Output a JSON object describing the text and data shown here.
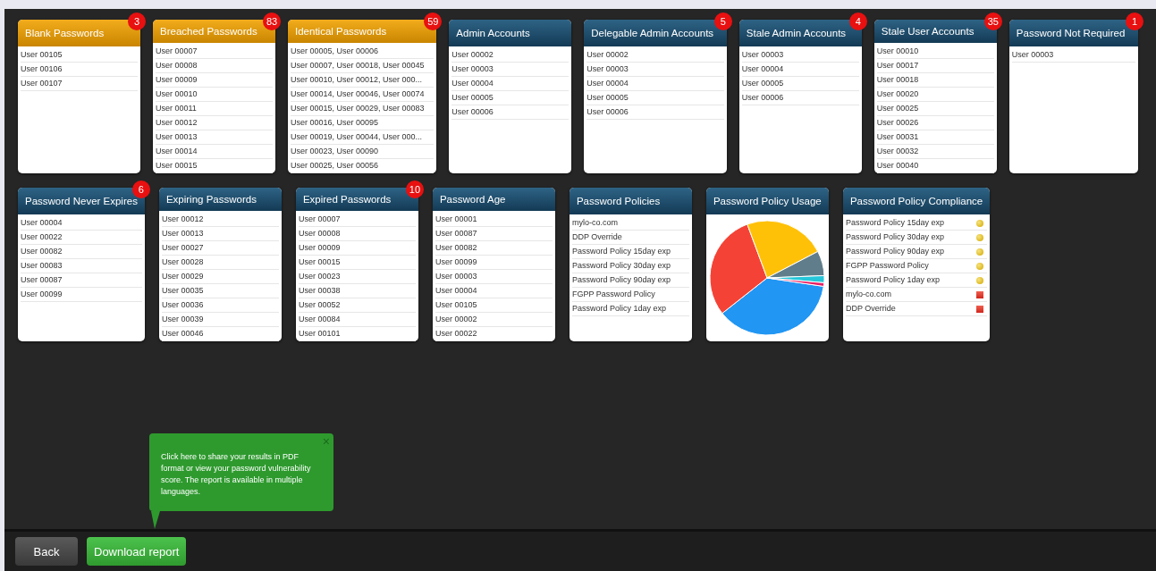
{
  "cards_row_1": [
    {
      "header": {
        "title": "Blank Passwords",
        "kind": "alert"
      },
      "badge": "3",
      "kind": "list",
      "rows": [
        "User 00105",
        "User 00106",
        "User 00107"
      ]
    },
    {
      "header": {
        "title": "Breached Passwords",
        "kind": "alert"
      },
      "badge": "83",
      "kind": "list",
      "rows": [
        "User 00007",
        "User 00008",
        "User 00009",
        "User 00010",
        "User 00011",
        "User 00012",
        "User 00013",
        "User 00014",
        "User 00015"
      ]
    },
    {
      "header": {
        "title": "Identical Passwords",
        "kind": "alert"
      },
      "badge": "59",
      "kind": "list",
      "rows": [
        "User 00005, User 00006",
        "User 00007, User 00018, User 00045",
        "User 00010, User 00012, User 000...",
        "User 00014, User 00046, User 00074",
        "User 00015, User 00029, User 00083",
        "User 00016, User 00095",
        "User 00019, User 00044, User 000...",
        "User 00023, User 00090",
        "User 00025, User 00056"
      ]
    },
    {
      "header": {
        "title": "Admin Accounts",
        "kind": "normal"
      },
      "kind": "list",
      "rows": [
        "User 00002",
        "User 00003",
        "User 00004",
        "User 00005",
        "User 00006"
      ]
    },
    {
      "header": {
        "title": "Delegable Admin Accounts",
        "kind": "normal"
      },
      "badge": "5",
      "kind": "list",
      "rows": [
        "User 00002",
        "User 00003",
        "User 00004",
        "User 00005",
        "User 00006"
      ]
    },
    {
      "header": {
        "title": "Stale Admin Accounts",
        "kind": "normal"
      },
      "badge": "4",
      "kind": "list",
      "rows": [
        "User 00003",
        "User 00004",
        "User 00005",
        "User 00006"
      ]
    },
    {
      "header": {
        "title": "Stale User Accounts",
        "kind": "normal"
      },
      "badge": "35",
      "kind": "list",
      "rows": [
        "User 00010",
        "User 00017",
        "User 00018",
        "User 00020",
        "User 00025",
        "User 00026",
        "User 00031",
        "User 00032",
        "User 00040"
      ]
    },
    {
      "header": {
        "title": "Password Not Required",
        "kind": "normal"
      },
      "badge": "1",
      "kind": "list",
      "rows": [
        "User 00003"
      ]
    }
  ],
  "cards_row_2": [
    {
      "header": {
        "title": "Password Never Expires",
        "kind": "normal"
      },
      "badge": "6",
      "kind": "list",
      "rows": [
        "User 00004",
        "User 00022",
        "User 00082",
        "User 00083",
        "User 00087",
        "User 00099"
      ]
    },
    {
      "header": {
        "title": "Expiring Passwords",
        "kind": "normal"
      },
      "kind": "list",
      "rows": [
        "User 00012",
        "User 00013",
        "User 00027",
        "User 00028",
        "User 00029",
        "User 00035",
        "User 00036",
        "User 00039",
        "User 00046"
      ]
    },
    {
      "header": {
        "title": "Expired Passwords",
        "kind": "normal"
      },
      "badge": "10",
      "kind": "list",
      "rows": [
        "User 00007",
        "User 00008",
        "User 00009",
        "User 00015",
        "User 00023",
        "User 00038",
        "User 00052",
        "User 00084",
        "User 00101"
      ]
    },
    {
      "header": {
        "title": "Password Age",
        "kind": "normal"
      },
      "kind": "list",
      "rows": [
        "User 00001",
        "User 00087",
        "User 00082",
        "User 00099",
        "User 00003",
        "User 00004",
        "User 00105",
        "User 00002",
        "User 00022"
      ]
    },
    {
      "header": {
        "title": "Password Policies",
        "kind": "normal"
      },
      "kind": "list",
      "rows": [
        "mylo-co.com",
        "DDP Override",
        "Password Policy 15day exp",
        "Password Policy 30day exp",
        "Password Policy 90day exp",
        "FGPP Password Policy",
        "Password Policy 1day exp"
      ]
    },
    {
      "header": {
        "title": "Password Policy Usage",
        "kind": "normal"
      },
      "kind": "chart"
    },
    {
      "header": {
        "title": "Password Policy Compliance",
        "kind": "normal"
      },
      "kind": "status",
      "rows": [
        {
          "label": "Password Policy 15day exp",
          "kind": "warning"
        },
        {
          "label": "Password Policy 30day exp",
          "kind": "warning"
        },
        {
          "label": "Password Policy 90day exp",
          "kind": "warning"
        },
        {
          "label": "FGPP Password Policy",
          "kind": "warning"
        },
        {
          "label": "Password Policy 1day exp",
          "kind": "warning"
        },
        {
          "label": "mylo-co.com",
          "kind": "fail"
        },
        {
          "label": "DDP Override",
          "kind": "fail"
        }
      ]
    }
  ],
  "tooltip": {
    "text": "Click here to share your results in PDF format or view your password vulnerability score. The report is available in multiple languages.",
    "close": "×"
  },
  "footer": {
    "buttons": [
      {
        "label": "Back",
        "kind": "secondary"
      },
      {
        "label": "Download report",
        "kind": "primary"
      }
    ]
  }
}
